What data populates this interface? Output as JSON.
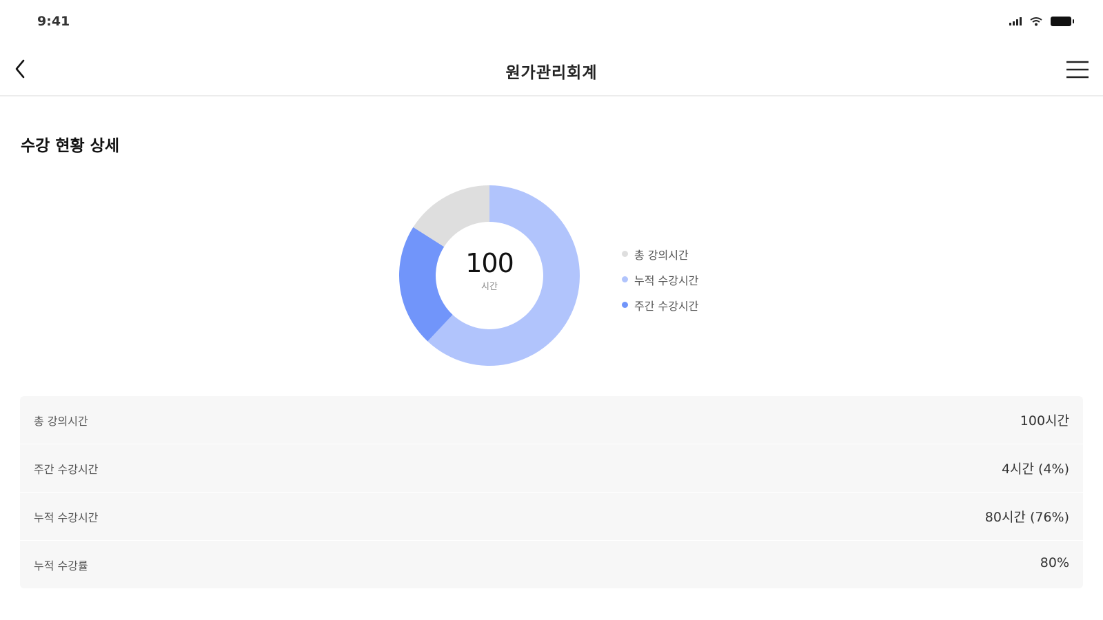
{
  "status_bar": {
    "time": "9:41",
    "icons": [
      "signal-icon",
      "wifi-icon",
      "battery-icon"
    ]
  },
  "nav": {
    "title": "원가관리회계",
    "back_icon": "chevron-left-icon",
    "menu_icon": "hamburger-menu-icon"
  },
  "section": {
    "title": "수강 현황 상세"
  },
  "chart_data": {
    "type": "pie",
    "center_value": "100",
    "center_unit": "시간",
    "slices": [
      {
        "name": "총 강의시간",
        "value": 16,
        "color": "#dedede"
      },
      {
        "name": "누적 수강시간",
        "value": 62,
        "color": "#b1c4fc"
      },
      {
        "name": "주간 수강시간",
        "value": 22,
        "color": "#7195fa"
      }
    ],
    "legend": [
      {
        "label": "총 강의시간",
        "color": "#dedede"
      },
      {
        "label": "누적 수강시간",
        "color": "#b1c4fc"
      },
      {
        "label": "주간 수강시간",
        "color": "#7195fa"
      }
    ],
    "legend_position": "right"
  },
  "table": {
    "rows": [
      {
        "label": "총 강의시간",
        "value": "100시간"
      },
      {
        "label": "주간 수강시간",
        "value": "4시간 (4%)"
      },
      {
        "label": "누적 수강시간",
        "value": "80시간 (76%)"
      },
      {
        "label": "누적 수강률",
        "value": "80%"
      }
    ]
  }
}
